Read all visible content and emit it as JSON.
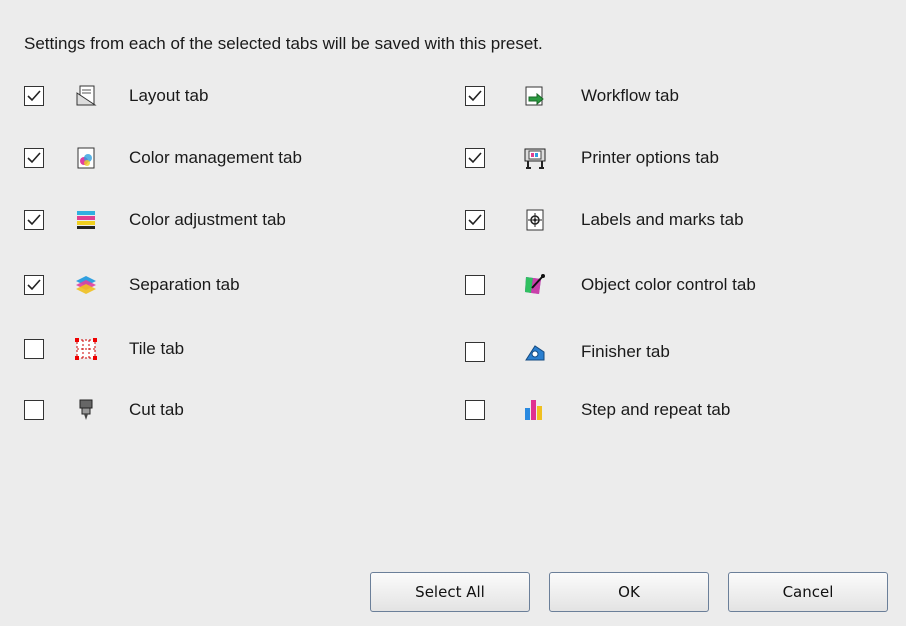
{
  "intro_text": "Settings from each of the selected tabs will be saved with this preset.",
  "left_column": [
    {
      "label": "Layout tab",
      "checked": true,
      "icon": "layout-icon"
    },
    {
      "label": "Color management tab",
      "checked": true,
      "icon": "color-management-icon"
    },
    {
      "label": "Color adjustment tab",
      "checked": true,
      "icon": "color-adjustment-icon"
    },
    {
      "label": "Separation tab",
      "checked": true,
      "icon": "separation-icon"
    },
    {
      "label": "Tile tab",
      "checked": false,
      "icon": "tile-icon"
    },
    {
      "label": "Cut tab",
      "checked": false,
      "icon": "cut-icon"
    }
  ],
  "right_column": [
    {
      "label": "Workflow tab",
      "checked": true,
      "icon": "workflow-icon"
    },
    {
      "label": "Printer options tab",
      "checked": true,
      "icon": "printer-options-icon"
    },
    {
      "label": "Labels and marks tab",
      "checked": true,
      "icon": "labels-marks-icon"
    },
    {
      "label": "Object color control tab",
      "checked": false,
      "icon": "object-color-icon"
    },
    {
      "label": "Finisher tab",
      "checked": false,
      "icon": "finisher-icon"
    },
    {
      "label": "Step and repeat tab",
      "checked": false,
      "icon": "step-repeat-icon"
    }
  ],
  "buttons": {
    "select_all": "Select All",
    "ok": "OK",
    "cancel": "Cancel"
  },
  "colors": {
    "background": "#ececec",
    "button_border": "#6b7f99"
  }
}
